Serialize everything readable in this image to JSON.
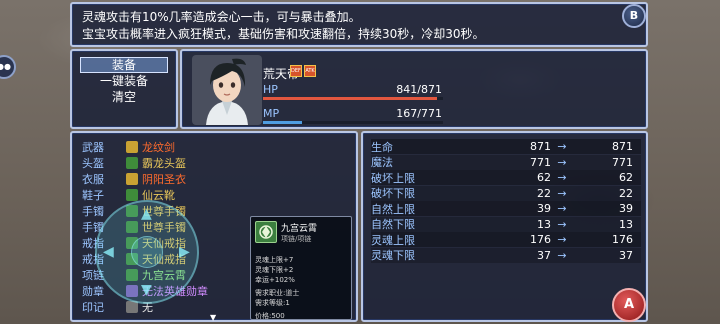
{
  "description": {
    "line1": "灵魂攻击有10%几率造成会心一击，可与暴击叠加。",
    "line2": "宝宝攻击概率进入疯狂模式，基础伤害和攻速翻倍，持续30秒，冷却30秒。"
  },
  "command_menu": {
    "items": [
      "装备",
      "一键装备",
      "清空"
    ],
    "selected_index": 0
  },
  "actor": {
    "name": "荒天帝",
    "state_icons": [
      "DEF",
      "ATK"
    ],
    "hp_label": "HP",
    "hp_value": "841/871",
    "hp_fraction": 0.9655,
    "mp_label": "MP",
    "mp_value": "167/771",
    "mp_fraction": 0.2166
  },
  "equipment": [
    {
      "slot": "武器",
      "item": "龙纹剑",
      "color": "r"
    },
    {
      "slot": "头盔",
      "item": "霸龙头盔",
      "color": "y"
    },
    {
      "slot": "衣服",
      "item": "阴阳圣衣",
      "color": "r"
    },
    {
      "slot": "鞋子",
      "item": "仙云靴",
      "color": "y"
    },
    {
      "slot": "手镯",
      "item": "世尊手镯",
      "color": "y"
    },
    {
      "slot": "手镯",
      "item": "世尊手镯",
      "color": "y"
    },
    {
      "slot": "戒指",
      "item": "天仙戒指",
      "color": "y"
    },
    {
      "slot": "戒指",
      "item": "天仙戒指",
      "color": "y"
    },
    {
      "slot": "项链",
      "item": "九宫云霄",
      "color": "g"
    },
    {
      "slot": "勋章",
      "item": "无法英雄勋章",
      "color": "p"
    },
    {
      "slot": "印记",
      "item": "无",
      "color": "empty"
    }
  ],
  "tooltip": {
    "name": "九宫云霄",
    "type": "项链/项链",
    "lines": [
      "灵魂上限+7",
      "灵魂下限+2",
      "幸运+102%",
      "需求职业:道士",
      "需求等级:1",
      "价格:500"
    ]
  },
  "params": [
    {
      "label": "生命",
      "old": "871",
      "arrow": "→",
      "new": "871"
    },
    {
      "label": "魔法",
      "old": "771",
      "arrow": "→",
      "new": "771"
    },
    {
      "label": "破坏上限",
      "old": "62",
      "arrow": "→",
      "new": "62"
    },
    {
      "label": "破坏下限",
      "old": "22",
      "arrow": "→",
      "new": "22"
    },
    {
      "label": "自然上限",
      "old": "39",
      "arrow": "→",
      "new": "39"
    },
    {
      "label": "自然下限",
      "old": "13",
      "arrow": "→",
      "new": "13"
    },
    {
      "label": "灵魂上限",
      "old": "176",
      "arrow": "→",
      "new": "176"
    },
    {
      "label": "灵魂下限",
      "old": "37",
      "arrow": "→",
      "new": "37"
    }
  ],
  "buttons": {
    "b": "B",
    "a": "A"
  },
  "colors": {
    "window_border": "#b9c6e4",
    "hp_bar": "#e2573f",
    "mp_bar": "#4f9de0",
    "system_blue": "#9cc5ff"
  }
}
